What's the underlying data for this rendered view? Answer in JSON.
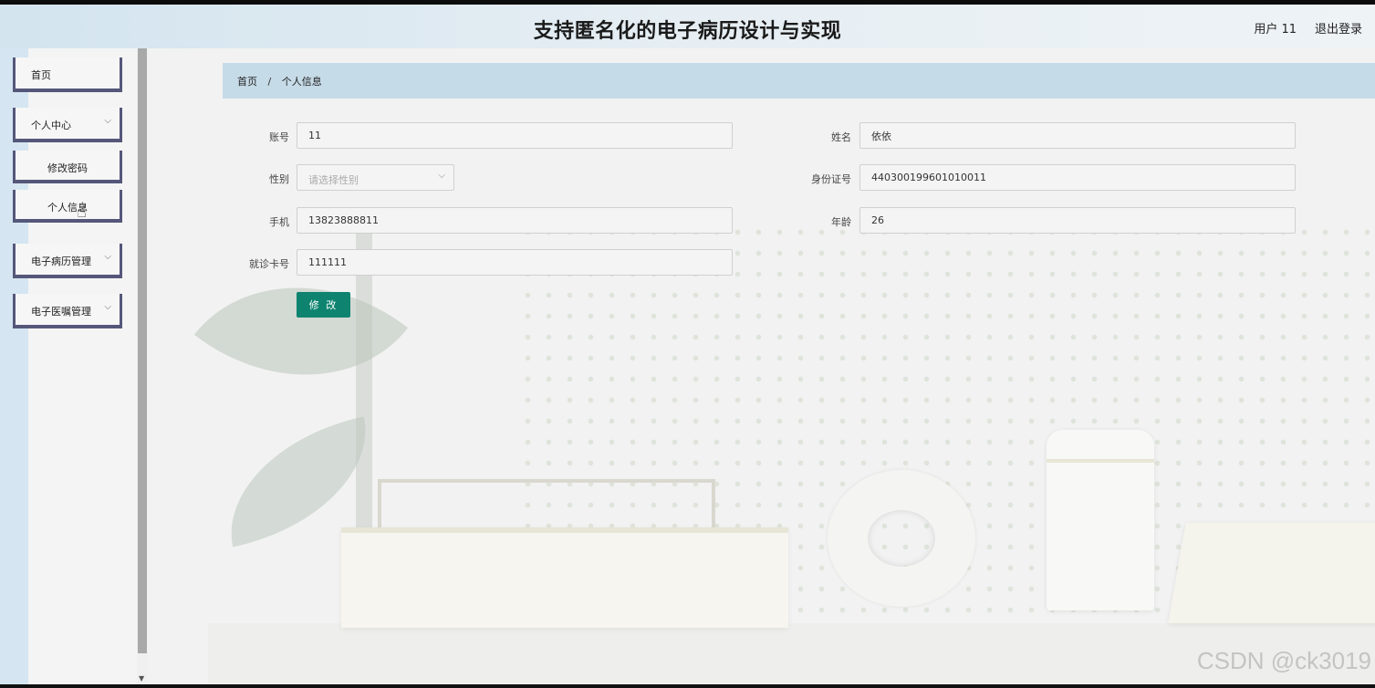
{
  "header": {
    "title": "支持匿名化的电子病历设计与实现",
    "user": "用户 11",
    "logout": "退出登录"
  },
  "sidebar": {
    "items": [
      {
        "label": "首页",
        "has_chevron": false
      },
      {
        "label": "个人中心",
        "has_chevron": true
      },
      {
        "label": "修改密码",
        "sub": true
      },
      {
        "label": "个人信息",
        "sub": true
      },
      {
        "label": "电子病历管理",
        "has_chevron": true
      },
      {
        "label": "电子医嘱管理",
        "has_chevron": true
      }
    ]
  },
  "breadcrumb": {
    "home": "首页",
    "separator": "/",
    "current": "个人信息"
  },
  "form": {
    "account": {
      "label": "账号",
      "value": "11"
    },
    "name": {
      "label": "姓名",
      "value": "依依"
    },
    "gender": {
      "label": "性别",
      "placeholder": "请选择性别"
    },
    "id_card": {
      "label": "身份证号",
      "value": "440300199601010011"
    },
    "phone": {
      "label": "手机",
      "value": "13823888811"
    },
    "age": {
      "label": "年龄",
      "value": "26"
    },
    "card_no": {
      "label": "就诊卡号",
      "value": "111111"
    },
    "submit": "修 改"
  },
  "watermark": "CSDN @ck3019",
  "colors": {
    "accent": "#0e8470",
    "sidebar_border": "#55577a",
    "breadcrumb_bg": "#c6dbe8"
  }
}
